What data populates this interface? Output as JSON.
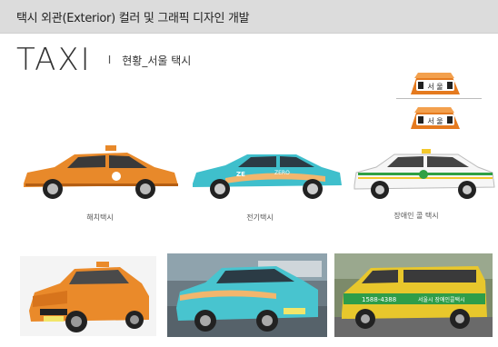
{
  "header": {
    "title": "택시 외관(Exterior) 컬러 및 그래픽 디자인 개발"
  },
  "heading": {
    "title": "TAXI",
    "separator": "I",
    "subtitle": "현황_서울 택시"
  },
  "roof_signs": [
    {
      "label": "서 울"
    },
    {
      "label": "서 울"
    }
  ],
  "cars": [
    {
      "caption": "해치택시",
      "color": "#e8892a"
    },
    {
      "caption": "전기택시",
      "color": "#3fbfcc"
    },
    {
      "caption": "장애인 콜 택시",
      "color": "#ffffff"
    }
  ],
  "car_texts": {
    "ev_logo_left": "ZE",
    "ev_logo_right": "ZERO",
    "phone": "1588-4388",
    "brand": "서울시 장애인콜택시"
  },
  "photos": [
    {
      "description_color": "#ea8a2a"
    },
    {
      "description_color": "#48c4cf"
    },
    {
      "description_color": "#e8c72c"
    }
  ]
}
